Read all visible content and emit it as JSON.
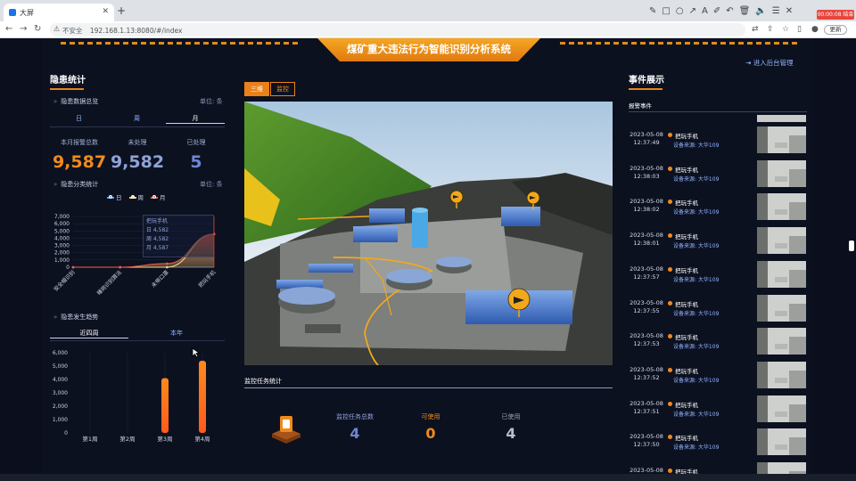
{
  "browser": {
    "tab_title": "大屏",
    "new_tab": "+",
    "security": "不安全",
    "url": "192.168.1.13:8080/#/index",
    "update_btn": "更新",
    "recording": "00:00:08 结束"
  },
  "header": {
    "title": "煤矿重大违法行为智能识别分析系统",
    "admin_link": "进入后台管理"
  },
  "left": {
    "section_title": "隐患统计",
    "overview": {
      "title": "隐患数据总览",
      "unit": "单位: 条",
      "tabs": [
        "日",
        "周",
        "月"
      ],
      "active_tab": "月",
      "stats": [
        {
          "label": "本月报警总数",
          "value": "9,587",
          "color": "#f08a1c"
        },
        {
          "label": "未处理",
          "value": "9,582",
          "color": "#8fa3d8"
        },
        {
          "label": "已处理",
          "value": "5",
          "color": "#6f86d6"
        }
      ]
    },
    "category": {
      "title": "隐患分类统计",
      "unit": "单位: 条",
      "legend": [
        {
          "name": "日",
          "color": "#4aa3ff"
        },
        {
          "name": "周",
          "color": "#ffd27a"
        },
        {
          "name": "月",
          "color": "#ff5a4a"
        }
      ],
      "tooltip": {
        "title": "把玩手机",
        "rows": [
          "日  4,582",
          "周  4,582",
          "月  4,587"
        ]
      }
    },
    "trend": {
      "title": "隐患发生趋势",
      "tabs": [
        "近四周",
        "本年"
      ],
      "active_tab": "近四周"
    }
  },
  "center": {
    "buttons": [
      "三维",
      "监控"
    ],
    "monitor": {
      "title": "监控任务统计",
      "stats": [
        {
          "label": "监控任务总数",
          "value": "4",
          "label_color": "#8fa3d8",
          "value_color": "#6f86d6"
        },
        {
          "label": "可使用",
          "value": "0",
          "label_color": "#f08a1c",
          "value_color": "#f08a1c"
        },
        {
          "label": "已使用",
          "value": "4",
          "label_color": "#9aa3b2",
          "value_color": "#b8bec9"
        }
      ]
    }
  },
  "right": {
    "section_title": "事件展示",
    "list_title": "报警事件",
    "events": [
      {
        "date": "2023-05-08",
        "time": "12:37:49",
        "type": "把玩手机",
        "source": "设备来源: 大华109"
      },
      {
        "date": "2023-05-08",
        "time": "12:38:03",
        "type": "把玩手机",
        "source": "设备来源: 大华109"
      },
      {
        "date": "2023-05-08",
        "time": "12:38:02",
        "type": "把玩手机",
        "source": "设备来源: 大华109"
      },
      {
        "date": "2023-05-08",
        "time": "12:38:01",
        "type": "把玩手机",
        "source": "设备来源: 大华109"
      },
      {
        "date": "2023-05-08",
        "time": "12:37:57",
        "type": "把玩手机",
        "source": "设备来源: 大华109"
      },
      {
        "date": "2023-05-08",
        "time": "12:37:55",
        "type": "把玩手机",
        "source": "设备来源: 大华109"
      },
      {
        "date": "2023-05-08",
        "time": "12:37:53",
        "type": "把玩手机",
        "source": "设备来源: 大华109"
      },
      {
        "date": "2023-05-08",
        "time": "12:37:52",
        "type": "把玩手机",
        "source": "设备来源: 大华109"
      },
      {
        "date": "2023-05-08",
        "time": "12:37:51",
        "type": "把玩手机",
        "source": "设备来源: 大华109"
      },
      {
        "date": "2023-05-08",
        "time": "12:37:50",
        "type": "把玩手机",
        "source": "设备来源: 大华109"
      },
      {
        "date": "2023-05-08",
        "time": "",
        "type": "把玩手机",
        "source": ""
      }
    ]
  },
  "chart_data": [
    {
      "type": "area",
      "categories": [
        "安全帽识别",
        "睡岗识别算法",
        "未带口罩",
        "把玩手机"
      ],
      "series": [
        {
          "name": "日",
          "values": [
            0,
            0,
            0,
            4582
          ]
        },
        {
          "name": "周",
          "values": [
            0,
            0,
            0,
            4582
          ]
        },
        {
          "name": "月",
          "values": [
            0,
            0,
            500,
            4587
          ]
        }
      ],
      "yticks": [
        "7,000",
        "6,000",
        "5,000",
        "4,000",
        "3,000",
        "2,000",
        "1,000",
        "0"
      ],
      "ylim": [
        0,
        7000
      ]
    },
    {
      "type": "bar",
      "categories": [
        "第1周",
        "第2周",
        "第3周",
        "第4周"
      ],
      "values": [
        0,
        0,
        4100,
        5400
      ],
      "yticks": [
        "6,000",
        "5,000",
        "4,000",
        "3,000",
        "2,000",
        "1,000",
        "0"
      ],
      "ylim": [
        0,
        6000
      ]
    }
  ]
}
